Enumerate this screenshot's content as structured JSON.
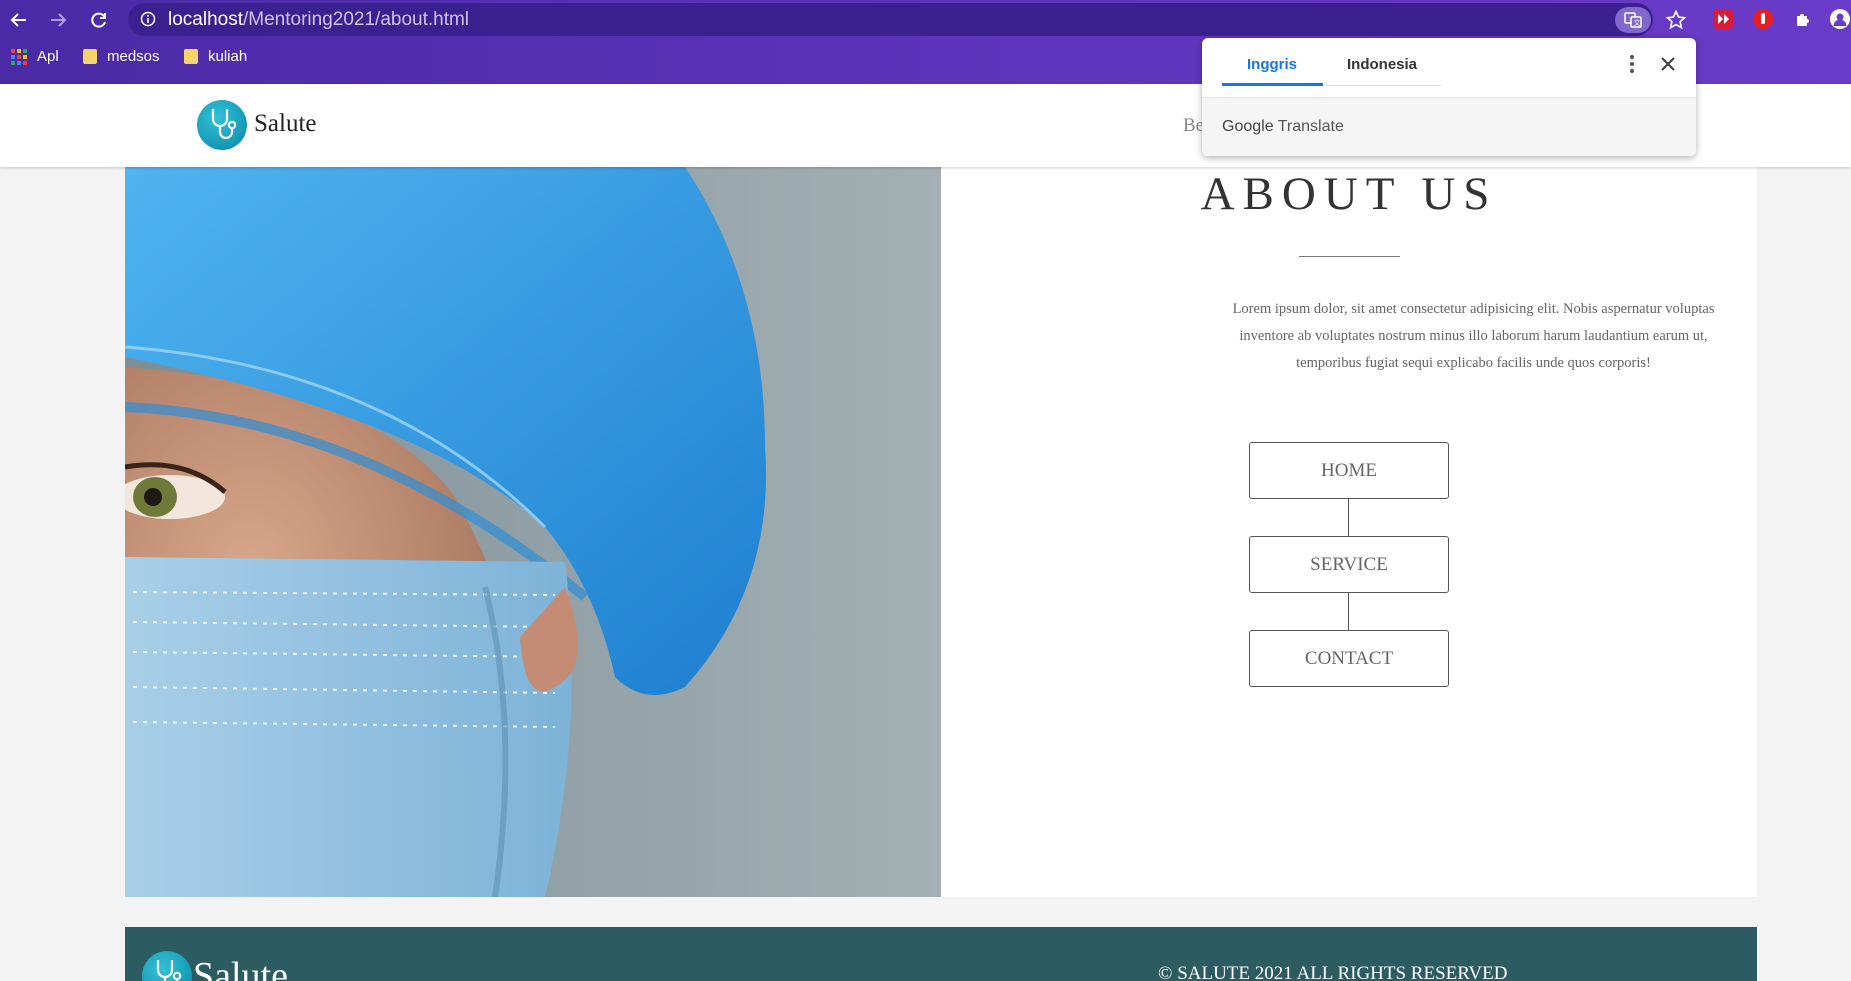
{
  "browser": {
    "url_host": "localhost",
    "url_path": "/Mentoring2021/about.html",
    "bookmarks": [
      {
        "label": "Apl",
        "icon": "apps-grid-icon"
      },
      {
        "label": "medsos",
        "icon": "folder-icon"
      },
      {
        "label": "kuliah",
        "icon": "folder-icon"
      }
    ]
  },
  "translate_popup": {
    "tabs": [
      "Inggris",
      "Indonesia"
    ],
    "active_tab": "Inggris",
    "footer_brand_google": "Google",
    "footer_brand_translate": "Translate"
  },
  "site": {
    "brand": "Salute",
    "nav_partial": "Be",
    "about_title": "ABOUT US",
    "about_text": "Lorem ipsum dolor, sit amet consectetur adipisicing elit. Nobis aspernatur voluptas inventore ab voluptates nostrum minus illo laborum harum laudantium earum ut, temporibus fugiat sequi explicabo facilis unde quos corporis!",
    "menu": [
      "HOME",
      "SERVICE",
      "CONTACT"
    ],
    "footer_brand": "Salute",
    "copyright": "SALUTE 2021 ALL RIGHTS RESERVED",
    "copyright_symbol": "©"
  },
  "colors": {
    "chrome_accent": "#5a32b8",
    "footer_bg": "#2c5b62",
    "translate_active": "#1a73e8",
    "logo": "#1597b5"
  }
}
